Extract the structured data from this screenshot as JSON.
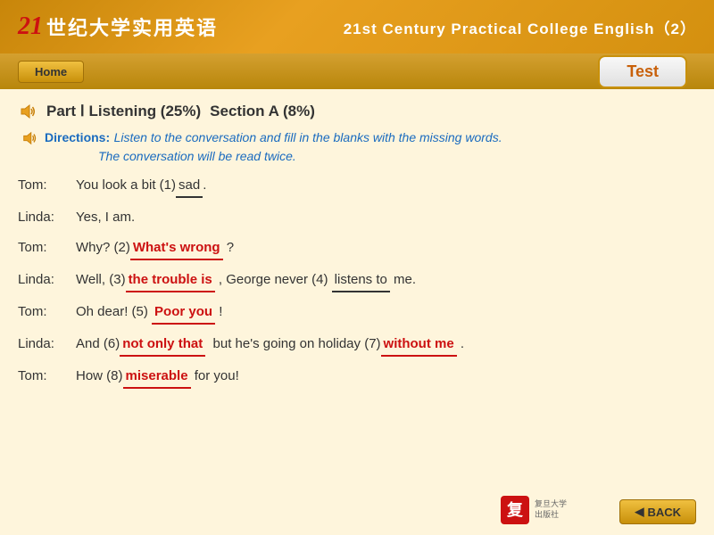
{
  "header": {
    "logo_number": "21",
    "logo_chinese": "世纪大学实用英语",
    "title": "21st Century Practical College English（2）",
    "home_label": "Home",
    "test_label": "Test"
  },
  "part": {
    "label": "Part Ⅰ Listening (25%)",
    "section": "Section A (8%)"
  },
  "directions": {
    "label": "Directions:",
    "text_line1": "Listen to the conversation and fill in the blanks with the missing words.",
    "text_line2": "The conversation will be read twice."
  },
  "dialogue": [
    {
      "speaker": "Tom:",
      "parts": [
        {
          "text": "You look a bit (1)",
          "type": "text"
        },
        {
          "text": "sad",
          "type": "blank-underline"
        },
        {
          "text": ".",
          "type": "text"
        }
      ]
    },
    {
      "speaker": "Linda:",
      "parts": [
        {
          "text": "Yes, I am.",
          "type": "text"
        }
      ]
    },
    {
      "speaker": "Tom:",
      "parts": [
        {
          "text": "Why? (2)",
          "type": "text"
        },
        {
          "text": "What's wrong",
          "type": "blank-red"
        },
        {
          "text": " ?",
          "type": "text"
        }
      ]
    },
    {
      "speaker": "Linda:",
      "parts": [
        {
          "text": "Well, (3)",
          "type": "text"
        },
        {
          "text": "the trouble is",
          "type": "blank-red"
        },
        {
          "text": ", George never  (4) ",
          "type": "text"
        },
        {
          "text": "listens to",
          "type": "blank-underline"
        },
        {
          "text": " me.",
          "type": "text"
        }
      ]
    },
    {
      "speaker": "Tom:",
      "parts": [
        {
          "text": "Oh dear! (5) ",
          "type": "text"
        },
        {
          "text": "Poor you",
          "type": "blank-red"
        },
        {
          "text": " !",
          "type": "text"
        }
      ]
    },
    {
      "speaker": "Linda:",
      "parts": [
        {
          "text": "And (6)",
          "type": "text"
        },
        {
          "text": "not only that",
          "type": "blank-red"
        },
        {
          "text": "  but he's going on holiday (7)",
          "type": "text"
        },
        {
          "text": "without me",
          "type": "blank-red"
        },
        {
          "text": " .",
          "type": "text"
        }
      ]
    },
    {
      "speaker": "Tom:",
      "parts": [
        {
          "text": "How (8)",
          "type": "text"
        },
        {
          "text": "miserable",
          "type": "blank-red"
        },
        {
          "text": " for you!",
          "type": "text"
        }
      ]
    }
  ],
  "back_button": {
    "label": "BACK"
  }
}
